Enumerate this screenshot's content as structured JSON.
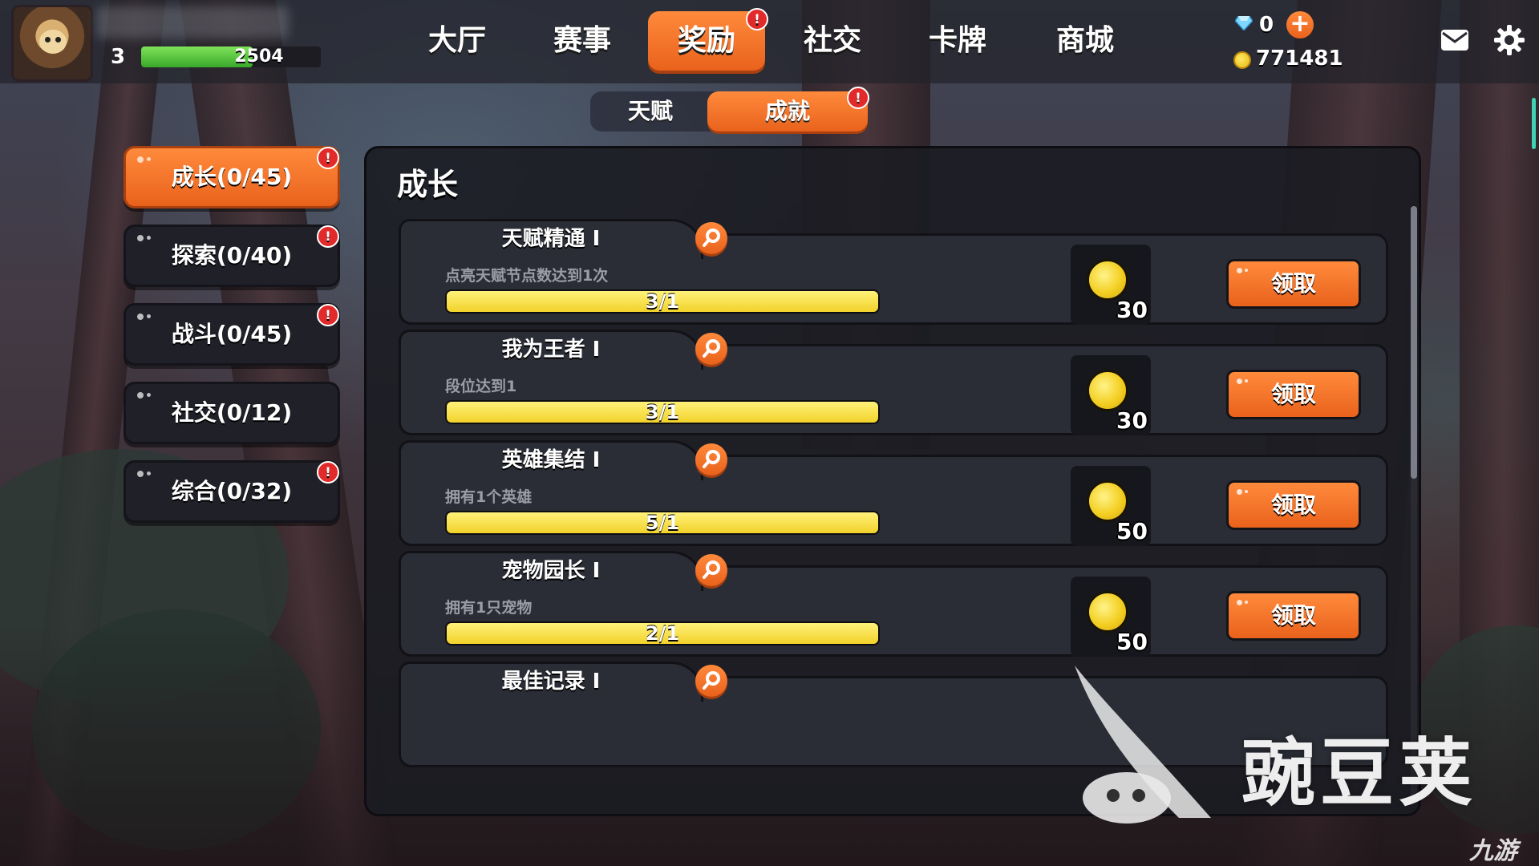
{
  "player": {
    "level": "3",
    "xp_value": "2504",
    "xp_progress": 0.62
  },
  "nav": {
    "tabs": [
      {
        "label": "大厅"
      },
      {
        "label": "赛事"
      },
      {
        "label": "奖励"
      },
      {
        "label": "社交"
      },
      {
        "label": "卡牌"
      },
      {
        "label": "商城"
      }
    ],
    "active_tab": "奖励",
    "alert_mark": "!"
  },
  "currency": {
    "diamonds": "0",
    "gold": "771481"
  },
  "sub_tabs": {
    "talent": "天赋",
    "achievement": "成就",
    "active": "成就",
    "alert_mark": "!"
  },
  "categories": [
    {
      "label": "成长(0/45)",
      "alert": "!"
    },
    {
      "label": "探索(0/40)",
      "alert": "!"
    },
    {
      "label": "战斗(0/45)",
      "alert": "!"
    },
    {
      "label": "社交(0/12)",
      "alert": ""
    },
    {
      "label": "综合(0/32)",
      "alert": "!"
    }
  ],
  "panel": {
    "title": "成长",
    "achievements": [
      {
        "name": "天赋精通 I",
        "desc": "点亮天赋节点数达到1次",
        "progress_text": "3/1",
        "progress": 1.0,
        "reward_qty": "30",
        "claim_label": "领取"
      },
      {
        "name": "我为王者 I",
        "desc": "段位达到1",
        "progress_text": "3/1",
        "progress": 1.0,
        "reward_qty": "30",
        "claim_label": "领取"
      },
      {
        "name": "英雄集结 I",
        "desc": "拥有1个英雄",
        "progress_text": "5/1",
        "progress": 1.0,
        "reward_qty": "50",
        "claim_label": "领取"
      },
      {
        "name": "宠物园长 I",
        "desc": "拥有1只宠物",
        "progress_text": "2/1",
        "progress": 1.0,
        "reward_qty": "50",
        "claim_label": "领取"
      },
      {
        "name": "最佳记录 I"
      }
    ]
  },
  "watermarks": {
    "main": "豌豆荚",
    "corner": "九游"
  },
  "colors": {
    "accent_orange": "#ef6d22",
    "progress_yellow": "#f5dc3a",
    "xp_green": "#5ccc3e",
    "alert_red": "#e22a2a"
  },
  "icons": {
    "diamond": "diamond-icon",
    "gold": "gold-coin-icon",
    "mail": "mail-icon",
    "settings": "gear-icon",
    "task_detail": "magnifier-icon",
    "reward": "gold-coin-icon"
  }
}
